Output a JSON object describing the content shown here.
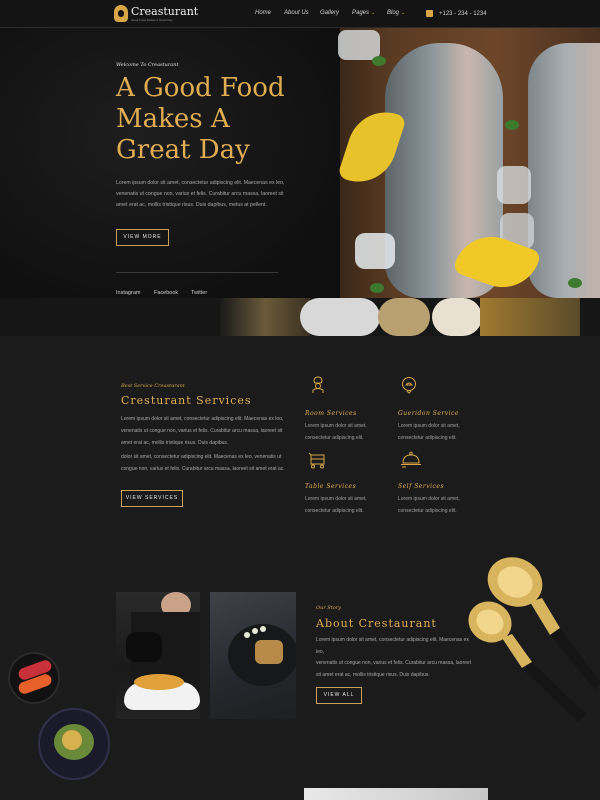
{
  "brand": {
    "name": "Creasturant",
    "tagline": "Good Food Makes A Great Day"
  },
  "nav": {
    "links": [
      {
        "label": "Home",
        "dropdown": false
      },
      {
        "label": "About Us",
        "dropdown": false
      },
      {
        "label": "Gallery",
        "dropdown": false
      },
      {
        "label": "Pages",
        "dropdown": true
      },
      {
        "label": "Blog",
        "dropdown": true
      }
    ],
    "phone": "+123 - 234 - 1234"
  },
  "hero": {
    "kicker": "Welcome To Creasturant",
    "title_lines": [
      "A Good Food",
      "Makes A",
      "Great Day"
    ],
    "text_lines": [
      "Lorem ipsum dolor sit amet, consectetur adipiscing elit. Maecenas ex leo,",
      "venenatis ut congue non, varius et felis. Curabitur arcu massa, laoreet sit",
      "amet erat ac, mollis tristique risus. Duis dapibus, metus at pellent."
    ],
    "button": "VIEW MORE",
    "social": [
      "Instagram",
      "Facebook",
      "Twitter"
    ]
  },
  "services": {
    "kicker": "Best Service Creasturant",
    "title": "Cresturant Services",
    "p1_lines": [
      "Lorem ipsum dolor sit amet, consectetur adipiscing elit. Maecenas ex leo,",
      "venenatis ut congue non, varius et felis. Curabitur arcu massa, laoreet sit",
      "amet erat ac, mollis tristique risus. Duis dapibus."
    ],
    "p2_lines": [
      "dolor sit amet, consectetur adipiscing elit. Maecenas ex leo, venenatis ut",
      "congue non, varius et felis. Curabitur arcu massa, laoreet sit amet erat ac."
    ],
    "button": "VIEW SERVICES",
    "items": [
      {
        "name": "Room Services",
        "icon": "chef-icon",
        "desc": [
          "Lorem ipsum dolor sit amet,",
          "consectetur adipiscing elit."
        ]
      },
      {
        "name": "Gueridon Service",
        "icon": "dish-icon",
        "desc": [
          "Lorem ipsum dolor sit amet,",
          "consectetur adipiscing elit."
        ]
      },
      {
        "name": "Table Services",
        "icon": "trolley-icon",
        "desc": [
          "Lorem ipsum dolor sit amet,",
          "consectetur adipiscing elit."
        ]
      },
      {
        "name": "Self Services",
        "icon": "cloche-icon",
        "desc": [
          "Lorem ipsum dolor sit amet,",
          "consectetur adipiscing elit."
        ]
      }
    ]
  },
  "about": {
    "kicker": "Our Story",
    "title": "About Crestaurant",
    "text_lines": [
      "Lorem ipsum dolor sit amet, consectetur adipiscing elit. Maecenas ex leo,",
      "venenatis ut congue non, varius et felis. Curabitur arcu massa, laoreet",
      "sit amet erat ac, mollis tristique risus. Duis dapibus."
    ],
    "button": "VIEW ALL"
  },
  "colors": {
    "accent": "#e0ad52",
    "background": "#1b1b1b",
    "nav": "#141414"
  }
}
